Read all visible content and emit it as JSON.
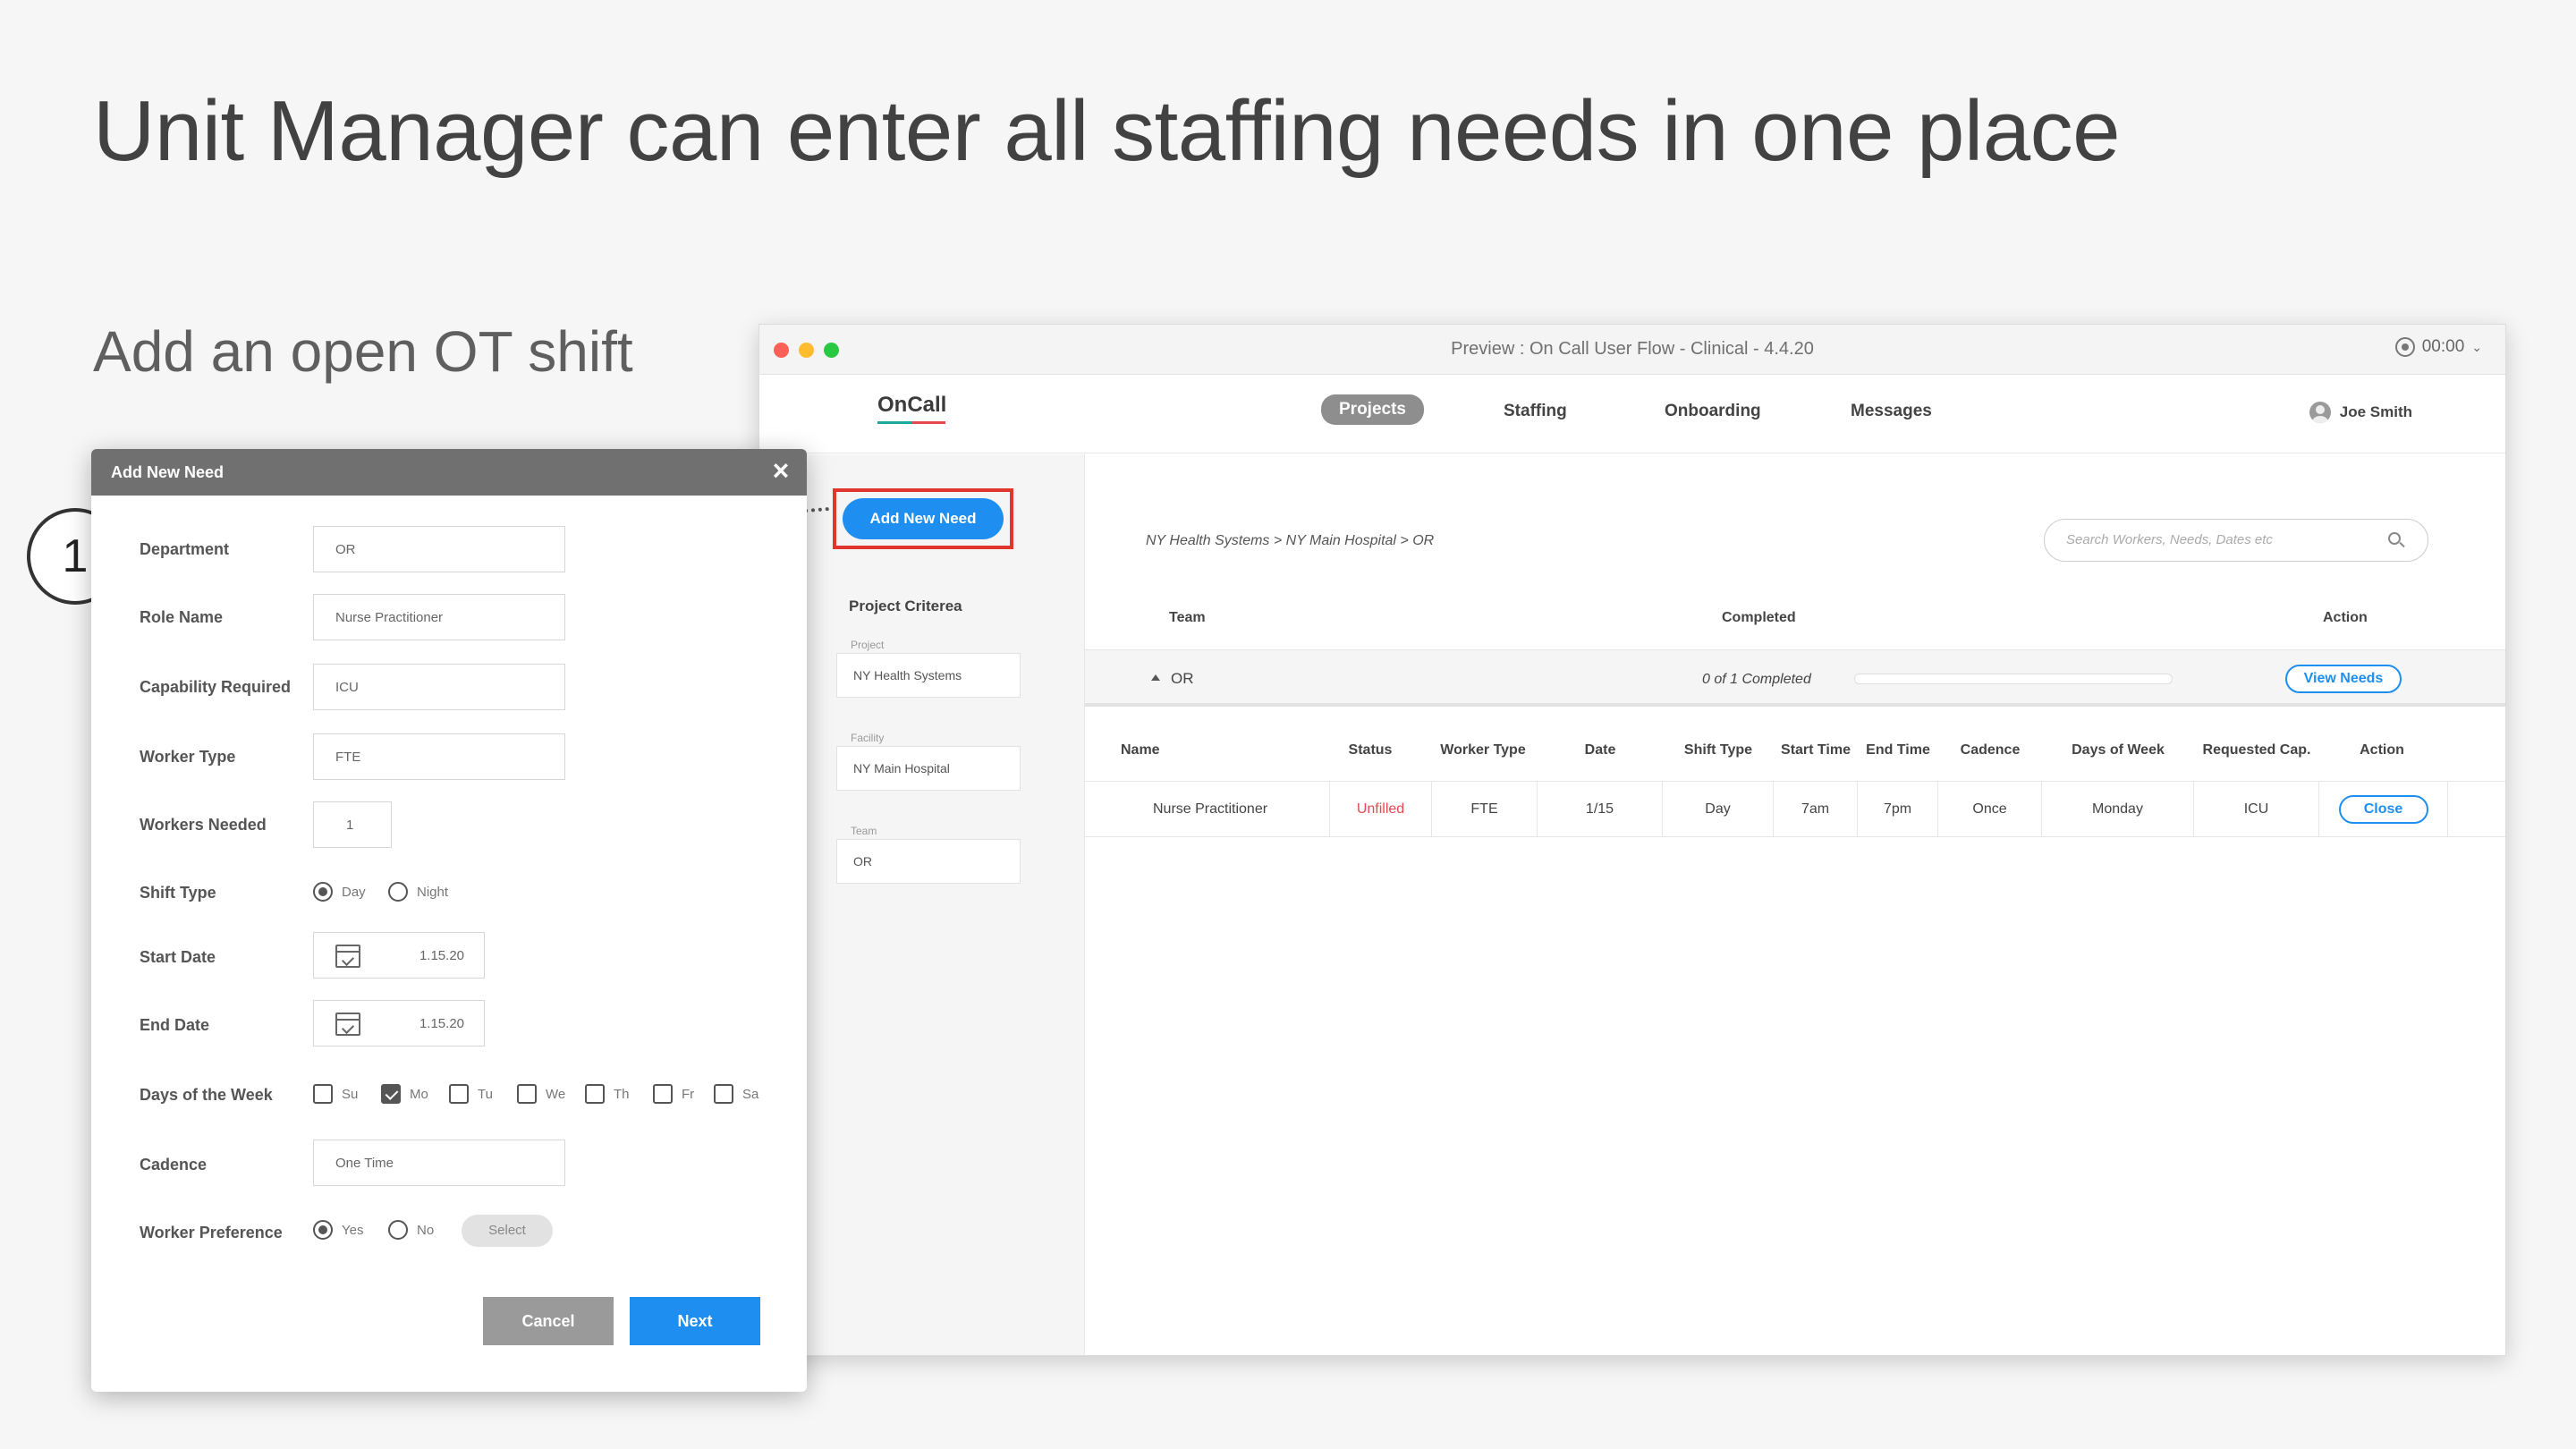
{
  "slide": {
    "title": "Unit Manager can enter all staffing needs in one place",
    "subtitle": "Add an open OT shift",
    "step_number": "1"
  },
  "window": {
    "title": "Preview : On Call User Flow - Clinical - 4.4.20",
    "clock": "00:00"
  },
  "nav": {
    "logo": "OnCall",
    "items": [
      "Projects",
      "Staffing",
      "Onboarding",
      "Messages"
    ],
    "active": "Projects",
    "user": "Joe Smith"
  },
  "sidebar": {
    "add_button": "Add New Need",
    "criteria_title": "Project Criterea",
    "fields": [
      {
        "label": "Project",
        "value": "NY Health Systems"
      },
      {
        "label": "Facility",
        "value": "NY Main Hospital"
      },
      {
        "label": "Team",
        "value": "OR"
      }
    ]
  },
  "main": {
    "breadcrumb": "NY Health Systems > NY Main Hospital > OR",
    "search_placeholder": "Search Workers, Needs, Dates etc",
    "team_headers": [
      "Team",
      "Completed",
      "Action"
    ],
    "team_row": {
      "name": "OR",
      "completed_text": "0 of 1 Completed",
      "progress": 0,
      "action": "View Needs"
    },
    "needs_headers": [
      "Name",
      "Status",
      "Worker Type",
      "Date",
      "Shift Type",
      "Start Time",
      "End Time",
      "Cadence",
      "Days of Week",
      "Requested Cap.",
      "Action"
    ],
    "needs_rows": [
      {
        "name": "Nurse Practitioner",
        "status": "Unfilled",
        "worker_type": "FTE",
        "date": "1/15",
        "shift_type": "Day",
        "start_time": "7am",
        "end_time": "7pm",
        "cadence": "Once",
        "days_of_week": "Monday",
        "requested_cap": "ICU",
        "action": "Close"
      }
    ]
  },
  "modal": {
    "title": "Add New Need",
    "labels": {
      "department": "Department",
      "role_name": "Role Name",
      "capability": "Capability Required",
      "worker_type": "Worker Type",
      "workers_needed": "Workers Needed",
      "shift_type": "Shift Type",
      "start_date": "Start Date",
      "end_date": "End Date",
      "days_of_week": "Days of the Week",
      "cadence": "Cadence",
      "worker_preference": "Worker Preference"
    },
    "values": {
      "department": "OR",
      "role_name": "Nurse Practitioner",
      "capability": "ICU",
      "worker_type": "FTE",
      "workers_needed": "1",
      "start_date": "1.15.20",
      "end_date": "1.15.20",
      "cadence": "One Time"
    },
    "shift_options": [
      "Day",
      "Night"
    ],
    "shift_selected": "Day",
    "days": [
      "Su",
      "Mo",
      "Tu",
      "We",
      "Th",
      "Fr",
      "Sa"
    ],
    "days_checked": [
      "Mo"
    ],
    "preference_options": [
      "Yes",
      "No"
    ],
    "preference_selected": "Yes",
    "select_label": "Select",
    "cancel": "Cancel",
    "next": "Next"
  },
  "colors": {
    "accent": "#1e8ff0",
    "highlight": "#e0362d",
    "unfilled": "#e8474e",
    "modal_header": "#707070"
  }
}
